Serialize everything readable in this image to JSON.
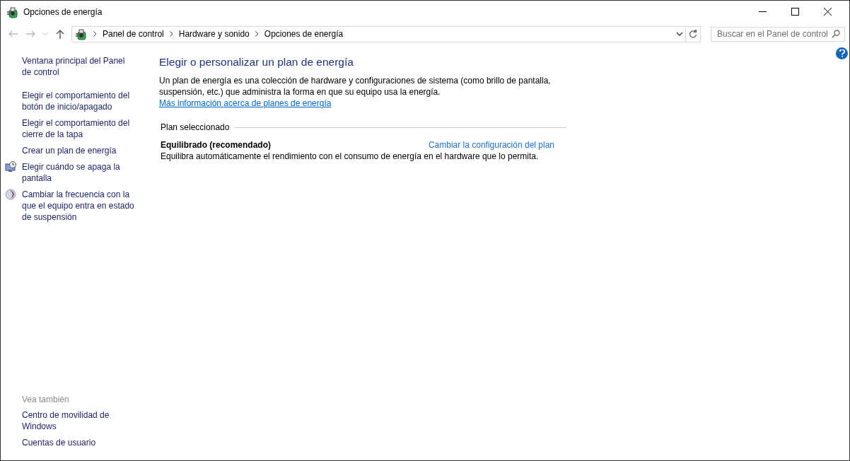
{
  "window": {
    "title": "Opciones de energía"
  },
  "address_bar": {
    "breadcrumbs": [
      "Panel de control",
      "Hardware y sonido",
      "Opciones de energía"
    ]
  },
  "search": {
    "placeholder": "Buscar en el Panel de control"
  },
  "sidebar": {
    "items": [
      {
        "label": "Ventana principal del Panel de control",
        "kind": "plain"
      },
      {
        "label": "Elegir el comportamiento del botón de inicio/apagado",
        "kind": "plain"
      },
      {
        "label": "Elegir el comportamiento del cierre de la tapa",
        "kind": "plain"
      },
      {
        "label": "Crear un plan de energía",
        "kind": "plain"
      },
      {
        "label": "Elegir cuándo se apaga la pantalla",
        "kind": "display"
      },
      {
        "label": "Cambiar la frecuencia con la que el equipo entra en estado de suspensión",
        "kind": "sleep"
      }
    ],
    "see_also": {
      "heading": "Vea también",
      "items": [
        {
          "label": "Centro de movilidad de Windows"
        },
        {
          "label": "Cuentas de usuario"
        }
      ]
    }
  },
  "content": {
    "title": "Elegir o personalizar un plan de energía",
    "description": "Un plan de energía es una colección de hardware y configuraciones de sistema (como brillo de pantalla, suspensión, etc.) que administra la forma en que su equipo usa la energía.",
    "info_link": "Más información acerca de planes de energía",
    "section": "Plan seleccionado",
    "plans": [
      {
        "name": "Equilibrado (recomendado)",
        "selected": true,
        "settings_link": "Cambiar la configuración del plan",
        "description": "Equilibra automáticamente el rendimiento con el consumo de energía en el hardware que lo permita."
      }
    ]
  }
}
